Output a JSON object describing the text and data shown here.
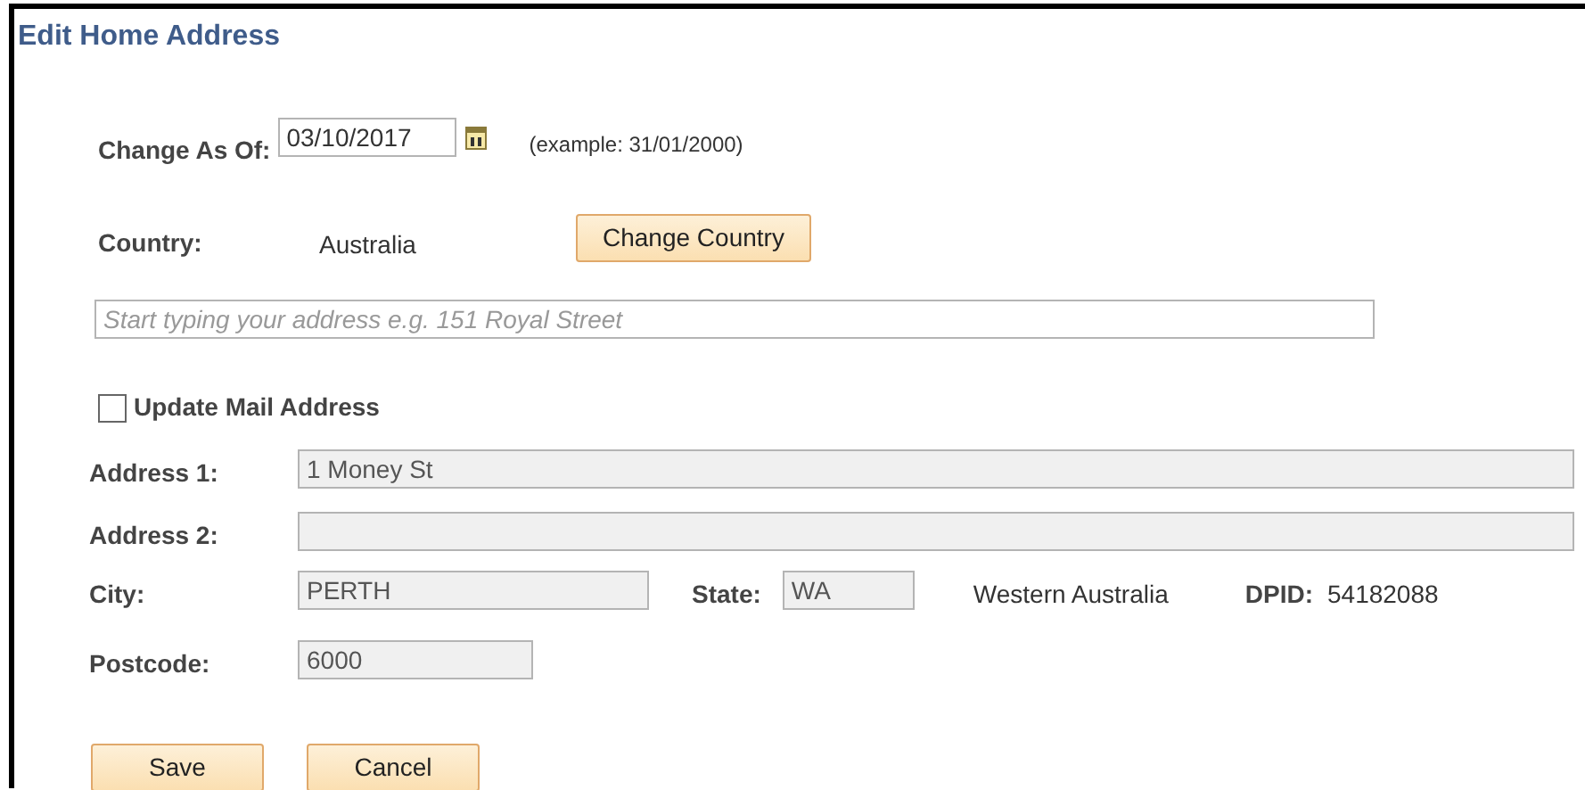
{
  "title": "Edit Home Address",
  "change_as_of": {
    "label": "Change As Of:",
    "value": "03/10/2017",
    "hint": "(example: 31/01/2000)"
  },
  "country": {
    "label": "Country:",
    "value": "Australia",
    "button": "Change Country"
  },
  "address_search": {
    "placeholder": "Start typing your address e.g. 151 Royal Street"
  },
  "update_mail": {
    "label": "Update Mail Address",
    "checked": false
  },
  "address1": {
    "label": "Address 1:",
    "value": "1 Money St",
    "disabled": true
  },
  "address2": {
    "label": "Address 2:",
    "disabled": true
  },
  "city": {
    "label": "City:",
    "value": "PERTH",
    "disabled": true
  },
  "state": {
    "label": "State:",
    "value": "WA",
    "disabled": true,
    "name": "Western Australia"
  },
  "dpid": {
    "label": "DPID:",
    "value": "54182088"
  },
  "postcode": {
    "label": "Postcode:",
    "value": "6000",
    "disabled": true
  },
  "buttons": [
    "Save",
    "Cancel"
  ]
}
